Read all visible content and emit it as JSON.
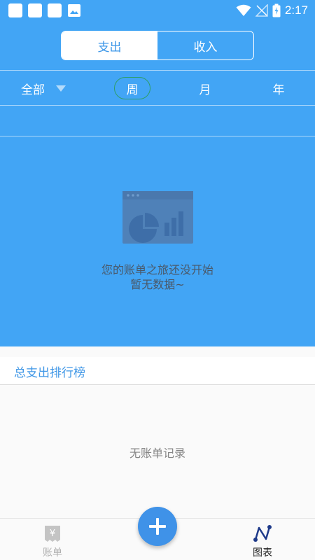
{
  "status_bar": {
    "time": "2:17",
    "icons": [
      "notification-square-icon",
      "notification-square-icon",
      "notification-square-icon",
      "image-icon",
      "wifi-icon",
      "no-signal-icon",
      "battery-charging-icon"
    ]
  },
  "segmented_control": {
    "expense_label": "支出",
    "income_label": "收入",
    "selected": "支出"
  },
  "period_filter": {
    "all_label": "全部",
    "week_label": "周",
    "month_label": "月",
    "year_label": "年",
    "selected": "周"
  },
  "empty_chart": {
    "line1": "您的账单之旅还没开始",
    "line2": "暂无数据~",
    "icon": "empty-chart-illustration-icon"
  },
  "ranking": {
    "title": "总支出排行榜",
    "empty_text": "无账单记录"
  },
  "bottom_nav": {
    "bills_label": "账单",
    "charts_label": "图表",
    "active": "图表",
    "add_icon": "plus-icon"
  },
  "colors": {
    "primary": "#42a5f5",
    "accent_text": "#3e96e6",
    "fab": "#3f92e8",
    "week_pill_border": "#2e9e6a"
  }
}
